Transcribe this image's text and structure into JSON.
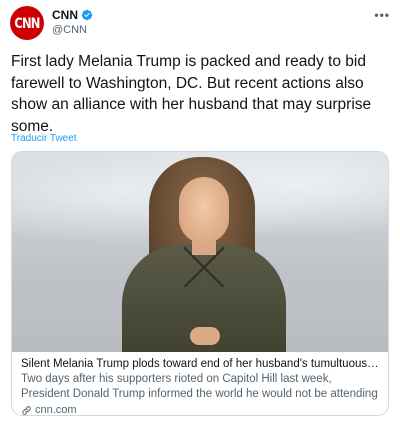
{
  "author": {
    "display_name": "CNN",
    "handle": "@CNN",
    "avatar_text": "CNN",
    "verified": true
  },
  "more_label": "•••",
  "tweet": {
    "text": "First lady Melania Trump is packed and ready to bid farewell to Washington, DC. But recent actions also show an alliance with her husband that may surprise some.",
    "translate_label": "Traducir Tweet"
  },
  "card": {
    "title": "Silent Melania Trump plods toward end of her husband's tumultuous term",
    "description": "Two days after his supporters rioted on Capitol Hill last week, President Donald Trump informed the world he would not be attending President-elect Joe Biden's…",
    "domain": "cnn.com"
  },
  "colors": {
    "brand_red": "#cc0000",
    "link_blue": "#1d9bf0",
    "secondary_text": "#536471",
    "primary_text": "#0f1419",
    "border": "#cfd9de"
  },
  "icons": {
    "verified": "verified-badge-icon",
    "more": "more-options-icon",
    "link": "link-icon"
  }
}
